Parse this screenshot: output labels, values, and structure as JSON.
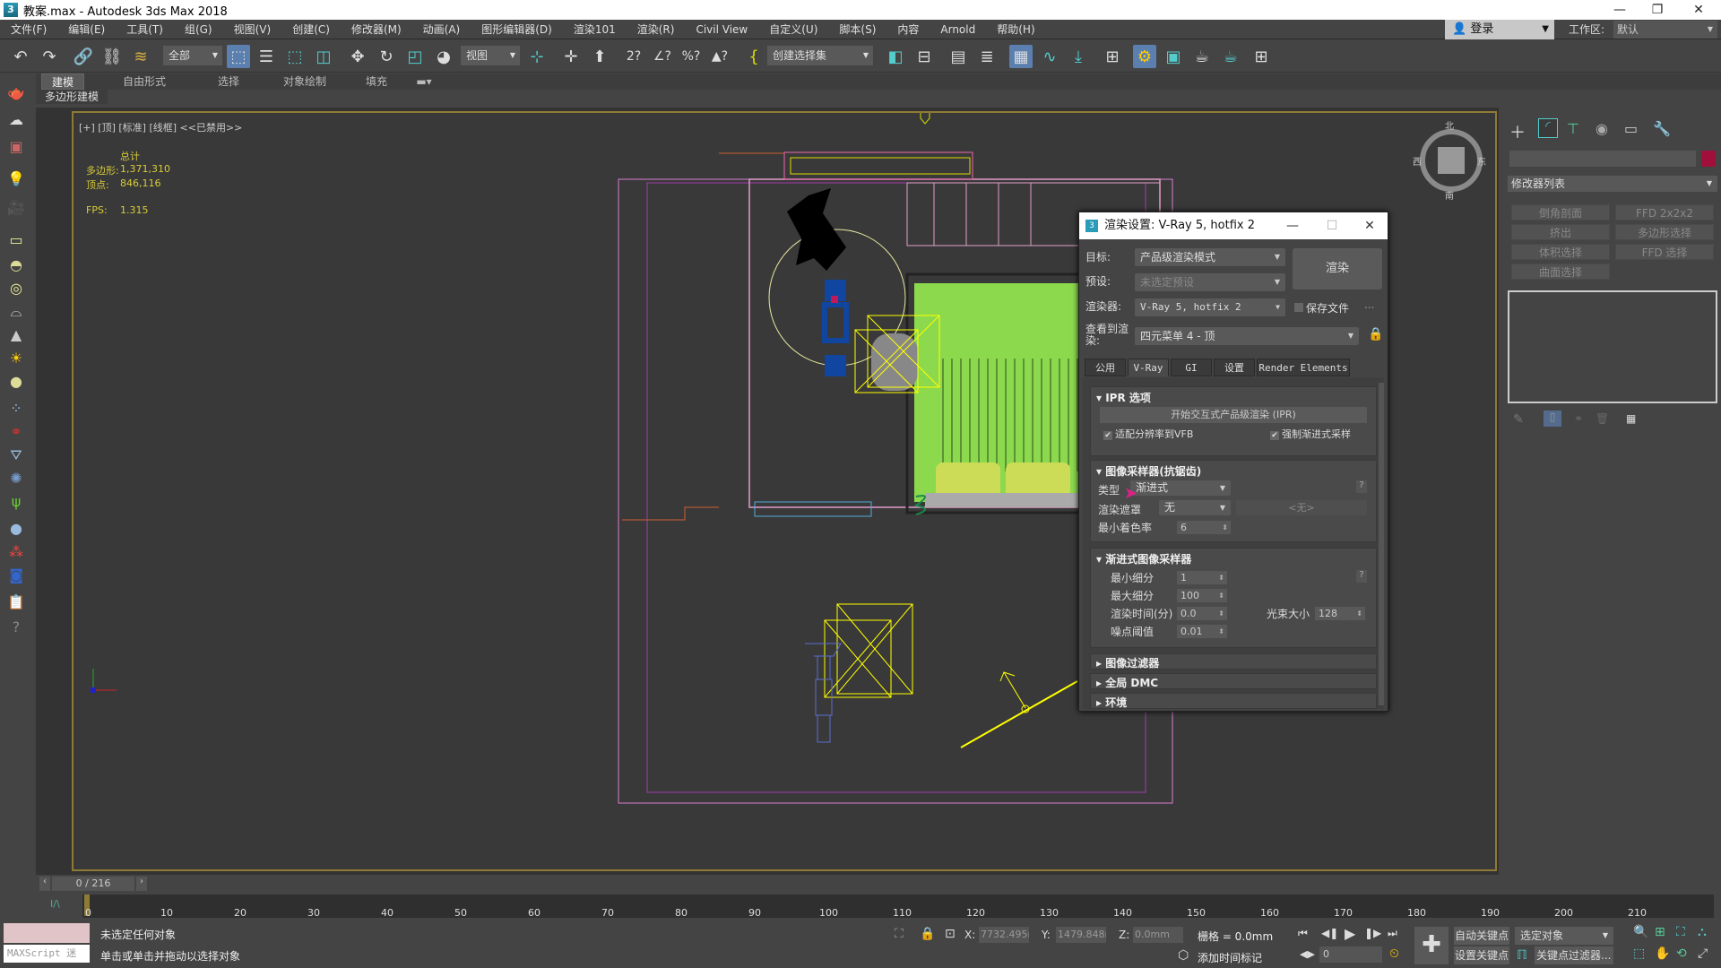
{
  "window": {
    "title": "教案.max - Autodesk 3ds Max 2018",
    "app_icon": "3",
    "minimize": "—",
    "restore": "❐",
    "close": "✕"
  },
  "menu": [
    "文件(F)",
    "编辑(E)",
    "工具(T)",
    "组(G)",
    "视图(V)",
    "创建(C)",
    "修改器(M)",
    "动画(A)",
    "图形编辑器(D)",
    "渲染101",
    "渲染(R)",
    "Civil View",
    "自定义(U)",
    "脚本(S)",
    "内容",
    "Arnold",
    "帮助(H)"
  ],
  "login": {
    "label": "登录",
    "icon": "user-icon"
  },
  "workspace": {
    "label": "工作区:",
    "value": "默认"
  },
  "toolbar": {
    "selection_filter": "全部",
    "ref_coord": "视图",
    "named_selection": "创建选择集",
    "icons": [
      "undo-icon",
      "redo-icon",
      "link-icon",
      "unlink-icon",
      "bind-spacewarp-icon",
      "select-object-icon",
      "select-by-name-icon",
      "rect-selection-icon",
      "window-crossing-icon",
      "move-icon",
      "rotate-icon",
      "scale-icon",
      "place-icon",
      "pivot-icon",
      "manipulate-icon",
      "keyboard-shortcut-icon",
      "snap-icon",
      "angle-snap-icon",
      "percent-snap-icon",
      "spinner-snap-icon",
      "edit-named-sel-icon",
      "mirror-icon",
      "align-icon",
      "scene-explorer-icon",
      "layer-explorer-icon",
      "ribbon-toggle-icon",
      "curve-editor-icon",
      "schematic-view-icon",
      "material-editor-icon",
      "render-setup-icon",
      "rendered-frame-icon",
      "render-production-icon",
      "render-iterative-icon",
      "viewport-layouts-icon"
    ]
  },
  "ribbon": {
    "tabs": [
      "建模",
      "自由形式",
      "选择",
      "对象绘制",
      "填充"
    ],
    "active": "建模",
    "sub": "多边形建模"
  },
  "viewport": {
    "label": "[+] [顶] [标准] [线框] <<已禁用>>",
    "stats": {
      "header": "总计",
      "poly_label": "多边形:",
      "poly_value": "1,371,310",
      "vert_label": "顶点:",
      "vert_value": "846,116",
      "fps_label": "FPS:",
      "fps_value": "1.315"
    },
    "viewcube": {
      "n": "北",
      "s": "南",
      "e": "东",
      "w": "西"
    }
  },
  "render_dialog": {
    "title": "渲染设置: V-Ray 5, hotfix 2",
    "target_label": "目标:",
    "target_value": "产品级渲染模式",
    "preset_label": "预设:",
    "preset_value": "未选定预设",
    "renderer_label": "渲染器:",
    "renderer_value": "V-Ray 5, hotfix 2",
    "save_file_label": "保存文件",
    "save_file_checked": false,
    "ellipsis": "...",
    "view_label": "查看到渲染:",
    "view_value": "四元菜单 4 - 顶",
    "render_button": "渲染",
    "tabs": [
      "公用",
      "V-Ray",
      "GI",
      "设置",
      "Render Elements"
    ],
    "active_tab": "V-Ray",
    "ipr": {
      "header": "IPR 选项",
      "start_button": "开始交互式产品级渲染 (IPR)",
      "fit_vfb": "适配分辨率到VFB",
      "fit_vfb_checked": true,
      "force_progressive": "强制渐进式采样",
      "force_progressive_checked": true
    },
    "image_sampler": {
      "header": "图像采样器(抗锯齿)",
      "type_label": "类型",
      "type_value": "渐进式",
      "mask_label": "渲染遮罩",
      "mask_value": "无",
      "mask_object": "<无>",
      "min_shading_label": "最小着色率",
      "min_shading_value": "6",
      "help": "?"
    },
    "progressive": {
      "header": "渐进式图像采样器",
      "min_subdiv_label": "最小细分",
      "min_subdiv": "1",
      "max_subdiv_label": "最大细分",
      "max_subdiv": "100",
      "render_time_label": "渲染时间(分)",
      "render_time": "0.0",
      "bundle_label": "光束大小",
      "bundle": "128",
      "noise_label": "噪点阈值",
      "noise": "0.01",
      "help": "?"
    },
    "collapsed": [
      "图像过滤器",
      "全局 DMC",
      "环境"
    ]
  },
  "command_panel": {
    "tabs": [
      "create-icon",
      "modify-icon",
      "hierarchy-icon",
      "motion-icon",
      "display-icon",
      "utilities-icon"
    ],
    "object_color": "#a0103a",
    "modifier_list": "修改器列表",
    "modifier_buttons": [
      "倒角剖面",
      "FFD 2x2x2",
      "挤出",
      "多边形选择",
      "体积选择",
      "FFD 选择",
      "曲面选择"
    ]
  },
  "timeline": {
    "frame": "0 / 216",
    "ticks": [
      "0",
      "10",
      "20",
      "30",
      "40",
      "50",
      "60",
      "70",
      "80",
      "90",
      "100",
      "110",
      "120",
      "130",
      "140",
      "150",
      "160",
      "170",
      "180",
      "190",
      "200",
      "210"
    ]
  },
  "status": {
    "maxscript": "MAXScript 迷",
    "line1": "未选定任何对象",
    "line2": "单击或单击并拖动以选择对象",
    "x_label": "X:",
    "x": "7732.495m",
    "y_label": "Y:",
    "y": "1479.848m",
    "z_label": "Z:",
    "z": "0.0mm",
    "grid": "栅格 = 0.0mm",
    "add_time_tag": "添加时间标记",
    "auto_key": "自动关键点",
    "set_key": "设置关键点",
    "key_target": "选定对象",
    "key_filters": "关键点过滤器...",
    "current_frame": "0"
  }
}
